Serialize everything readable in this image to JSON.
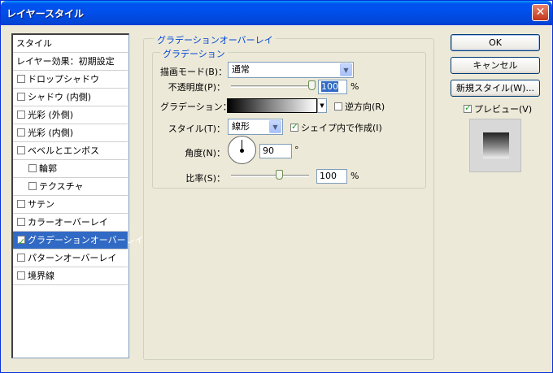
{
  "window": {
    "title": "レイヤースタイル",
    "close_glyph": "✕"
  },
  "style_list": [
    {
      "label": "スタイル",
      "checkbox": false,
      "checked": false,
      "indent": false,
      "selected": false,
      "header": true
    },
    {
      "label": "レイヤー効果：初期設定",
      "checkbox": false,
      "checked": false,
      "indent": false,
      "selected": false,
      "header": true
    },
    {
      "label": "ドロップシャドウ",
      "checkbox": true,
      "checked": false,
      "indent": false,
      "selected": false
    },
    {
      "label": "シャドウ (内側)",
      "checkbox": true,
      "checked": false,
      "indent": false,
      "selected": false
    },
    {
      "label": "光彩 (外側)",
      "checkbox": true,
      "checked": false,
      "indent": false,
      "selected": false
    },
    {
      "label": "光彩 (内側)",
      "checkbox": true,
      "checked": false,
      "indent": false,
      "selected": false
    },
    {
      "label": "ベベルとエンボス",
      "checkbox": true,
      "checked": false,
      "indent": false,
      "selected": false
    },
    {
      "label": "輪郭",
      "checkbox": true,
      "checked": false,
      "indent": true,
      "selected": false
    },
    {
      "label": "テクスチャ",
      "checkbox": true,
      "checked": false,
      "indent": true,
      "selected": false
    },
    {
      "label": "サテン",
      "checkbox": true,
      "checked": false,
      "indent": false,
      "selected": false
    },
    {
      "label": "カラーオーバーレイ",
      "checkbox": true,
      "checked": false,
      "indent": false,
      "selected": false
    },
    {
      "label": "グラデーションオーバーレイ",
      "checkbox": true,
      "checked": true,
      "indent": false,
      "selected": true
    },
    {
      "label": "パターンオーバーレイ",
      "checkbox": true,
      "checked": false,
      "indent": false,
      "selected": false
    },
    {
      "label": "境界線",
      "checkbox": true,
      "checked": false,
      "indent": false,
      "selected": false
    }
  ],
  "panel": {
    "group_title": "グラデーションオーバーレイ",
    "subgroup_title": "グラデーション",
    "blend_mode": {
      "label": "描画モード(B)：",
      "value": "通常"
    },
    "opacity": {
      "label": "不透明度(P)：",
      "value": "100",
      "unit": "%",
      "level": 1.0
    },
    "gradient": {
      "label": "グラデーション：",
      "reverse_label": "逆方向(R)",
      "reverse_checked": false
    },
    "style": {
      "label": "スタイル(T)：",
      "value": "線形",
      "align_label": "シェイプ内で作成(I)",
      "align_checked": true
    },
    "angle": {
      "label": "角度(N)：",
      "value": "90",
      "unit": "°"
    },
    "scale": {
      "label": "比率(S)：",
      "value": "100",
      "unit": "%",
      "level": 0.62
    }
  },
  "buttons": {
    "ok": "OK",
    "cancel": "キャンセル",
    "new_style": "新規スタイル(W)...",
    "preview_label": "プレビュー(V)",
    "preview_checked": true
  }
}
